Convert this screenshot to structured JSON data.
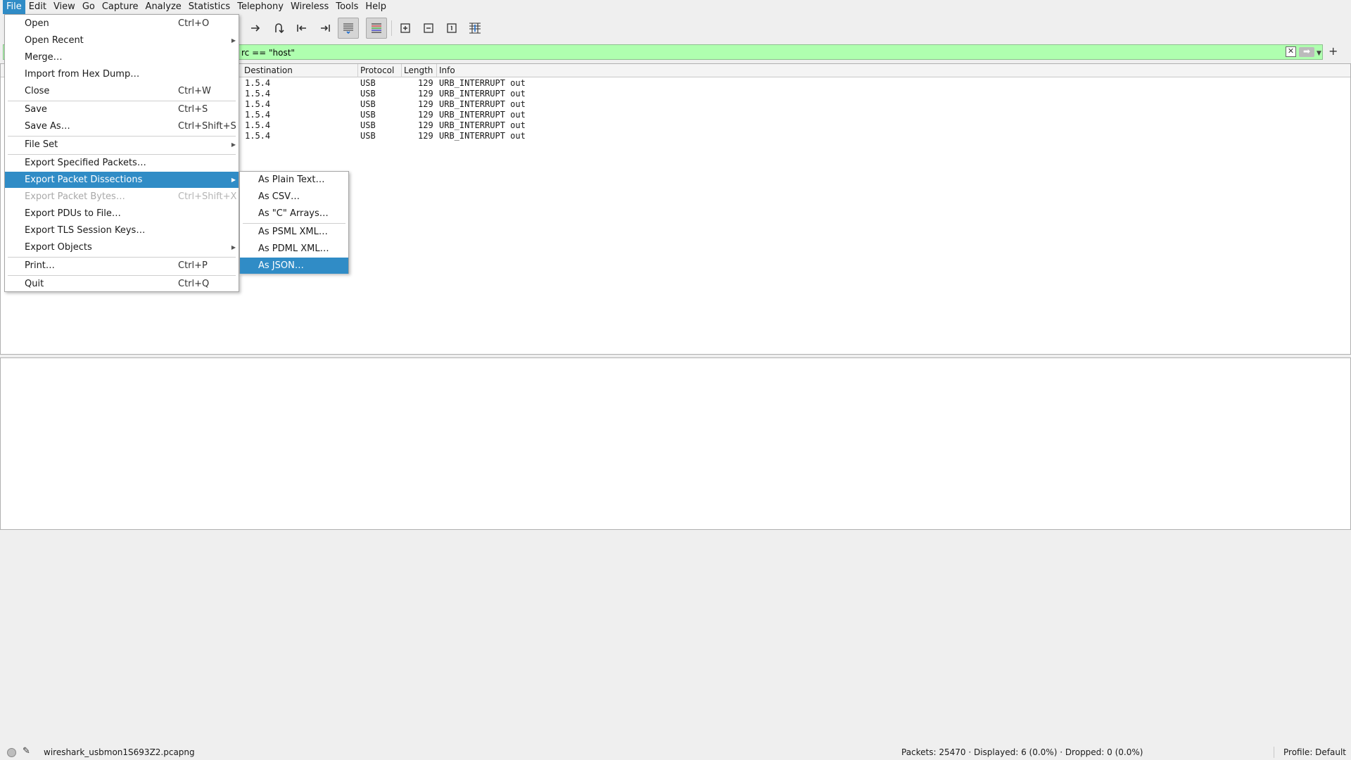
{
  "menubar": {
    "items": [
      "File",
      "Edit",
      "View",
      "Go",
      "Capture",
      "Analyze",
      "Statistics",
      "Telephony",
      "Wireless",
      "Tools",
      "Help"
    ]
  },
  "filter": {
    "value": "rc == \"host\""
  },
  "packet_list": {
    "columns": [
      "Destination",
      "Protocol",
      "Length",
      "Info"
    ],
    "rows": [
      {
        "destination": "1.5.4",
        "protocol": "USB",
        "length": "129",
        "info": "URB_INTERRUPT out"
      },
      {
        "destination": "1.5.4",
        "protocol": "USB",
        "length": "129",
        "info": "URB_INTERRUPT out"
      },
      {
        "destination": "1.5.4",
        "protocol": "USB",
        "length": "129",
        "info": "URB_INTERRUPT out"
      },
      {
        "destination": "1.5.4",
        "protocol": "USB",
        "length": "129",
        "info": "URB_INTERRUPT out"
      },
      {
        "destination": "1.5.4",
        "protocol": "USB",
        "length": "129",
        "info": "URB_INTERRUPT out"
      },
      {
        "destination": "1.5.4",
        "protocol": "USB",
        "length": "129",
        "info": "URB_INTERRUPT out"
      }
    ]
  },
  "file_menu": {
    "items": [
      {
        "label": "Open",
        "shortcut": "Ctrl+O"
      },
      {
        "label": "Open Recent",
        "shortcut": ""
      },
      {
        "label": "Merge…",
        "shortcut": ""
      },
      {
        "label": "Import from Hex Dump…",
        "shortcut": ""
      },
      {
        "label": "Close",
        "shortcut": "Ctrl+W"
      },
      {
        "label": "Save",
        "shortcut": "Ctrl+S"
      },
      {
        "label": "Save As…",
        "shortcut": "Ctrl+Shift+S"
      },
      {
        "label": "File Set",
        "shortcut": ""
      },
      {
        "label": "Export Specified Packets…",
        "shortcut": ""
      },
      {
        "label": "Export Packet Dissections",
        "shortcut": ""
      },
      {
        "label": "Export Packet Bytes…",
        "shortcut": "Ctrl+Shift+X"
      },
      {
        "label": "Export PDUs to File…",
        "shortcut": ""
      },
      {
        "label": "Export TLS Session Keys…",
        "shortcut": ""
      },
      {
        "label": "Export Objects",
        "shortcut": ""
      },
      {
        "label": "Print…",
        "shortcut": "Ctrl+P"
      },
      {
        "label": "Quit",
        "shortcut": "Ctrl+Q"
      }
    ]
  },
  "export_submenu": {
    "items": [
      "As Plain Text…",
      "As CSV…",
      "As \"C\" Arrays…",
      "As PSML XML…",
      "As PDML XML…",
      "As JSON…"
    ]
  },
  "statusbar": {
    "file": "wireshark_usbmon1S693Z2.pcapng",
    "packets": "Packets: 25470 · Displayed: 6 (0.0%) · Dropped: 0 (0.0%)",
    "profile": "Profile: Default"
  },
  "colors": {
    "highlight": "#308cc6",
    "filter_valid": "#afffaf"
  }
}
